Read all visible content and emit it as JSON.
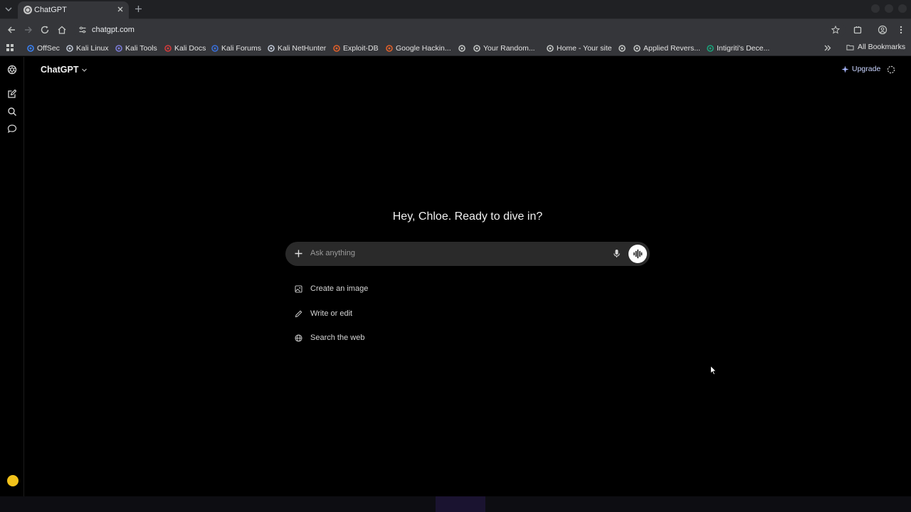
{
  "browser": {
    "tab": {
      "title": "ChatGPT"
    },
    "url": "chatgpt.com",
    "bookmarks": [
      {
        "label": "OffSec",
        "icon": "offsec-icon",
        "color": "#3b82f6"
      },
      {
        "label": "Kali Linux",
        "icon": "kali-dragon-icon",
        "color": "#bfc7d5"
      },
      {
        "label": "Kali Tools",
        "icon": "kali-tools-icon",
        "color": "#7b7bd8"
      },
      {
        "label": "Kali Docs",
        "icon": "kali-docs-icon",
        "color": "#d13b3b"
      },
      {
        "label": "Kali Forums",
        "icon": "kali-forums-icon",
        "color": "#3a6fd8"
      },
      {
        "label": "Kali NetHunter",
        "icon": "kali-dragon-icon",
        "color": "#bfc7d5"
      },
      {
        "label": "Exploit-DB",
        "icon": "exploit-db-icon",
        "color": "#e0602a"
      },
      {
        "label": "Google Hackin...",
        "icon": "ghdb-icon",
        "color": "#e0602a"
      },
      {
        "label": "",
        "icon": "globe-icon",
        "color": "#c4c7c5"
      },
      {
        "label": "Your Random...",
        "icon": "wordpress-icon",
        "color": "#c4c7c5"
      },
      {
        "label": "Home - Your site",
        "icon": "globe-icon",
        "color": "#c4c7c5"
      },
      {
        "label": "",
        "icon": "globe-icon",
        "color": "#c4c7c5"
      },
      {
        "label": "Applied Revers...",
        "icon": "globe-icon",
        "color": "#c4c7c5"
      },
      {
        "label": "Intigriti's Dece...",
        "icon": "intigriti-icon",
        "color": "#1aa37a"
      }
    ],
    "all_bookmarks": "All Bookmarks"
  },
  "app": {
    "model_name": "ChatGPT",
    "upgrade_label": "Upgrade",
    "greeting": "Hey, Chloe. Ready to dive in?",
    "composer_placeholder": "Ask anything",
    "suggestions": [
      {
        "label": "Create an image",
        "icon": "image-icon"
      },
      {
        "label": "Write or edit",
        "icon": "pencil-icon"
      },
      {
        "label": "Search the web",
        "icon": "globe-icon"
      }
    ],
    "sidebar_icons": [
      "openai-logo-icon",
      "new-chat-icon",
      "search-icon",
      "chat-bubble-icon"
    ],
    "accent": "#f2c21a"
  }
}
